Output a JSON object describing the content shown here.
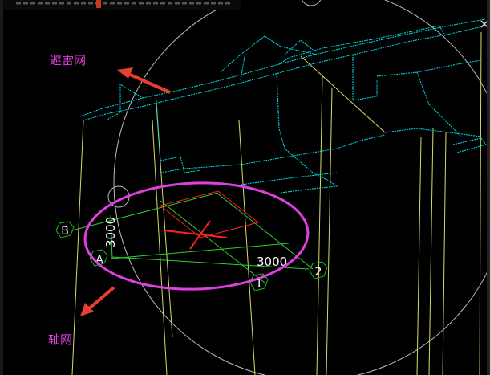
{
  "annotations": {
    "lightning_grid": "避雷网",
    "axis_grid": "轴网"
  },
  "axes": {
    "A": "A",
    "B": "B",
    "one": "1",
    "two": "2"
  },
  "dimensions": {
    "horizontal": "3000",
    "vertical": "3000"
  },
  "top_title_fragment": "",
  "colors": {
    "background": "#000000",
    "roof_outline": "#00e5ee",
    "structure_lines": "#d9d96a",
    "axis_lines": "#2fd02f",
    "axis_bubbles": "#1fb81f",
    "highlight_rect": "#ff2020",
    "annotation_text": "#e040e0",
    "ellipse": "#e040e0",
    "arrows": "#e84030",
    "view_circle": "#bfbfbf"
  },
  "icons": {
    "crosshair": "crosshair-icon",
    "close": "close-icon"
  }
}
